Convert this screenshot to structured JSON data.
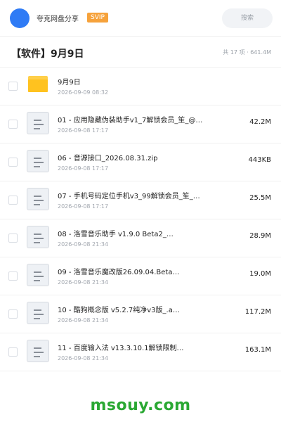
{
  "header": {
    "app_name": "夸克网盘分享",
    "badge": "SVIP",
    "search_placeholder": "搜索"
  },
  "folder": {
    "title": "【软件】9月9日",
    "summary": "共 17 项 · 641.4M"
  },
  "files": [
    {
      "type": "folder",
      "icon": "folder-icon",
      "name": "9月9日",
      "date": "2026-09-09 08:32",
      "size": ""
    },
    {
      "type": "file",
      "icon": "document-icon",
      "name": "01 - 应用隐藏伪装助手v1_7解锁会员_笙_@…",
      "date": "2026-09-08 17:17",
      "size": "42.2M"
    },
    {
      "type": "file",
      "icon": "document-icon",
      "name": "06 - 音源接口_2026.08.31.zip",
      "date": "2026-09-08 17:17",
      "size": "443KB"
    },
    {
      "type": "file",
      "icon": "document-icon",
      "name": "07 - 手机号码定位手机v3_99解锁会员_笙_…",
      "date": "2026-09-08 17:17",
      "size": "25.5M"
    },
    {
      "type": "file",
      "icon": "document-icon",
      "name": "08 - 洛雪音乐助手 v1.9.0 Beta2_…",
      "date": "2026-09-08 21:34",
      "size": "28.9M"
    },
    {
      "type": "file",
      "icon": "document-icon",
      "name": "09 - 洛雪音乐魔改版26.09.04.Beta…",
      "date": "2026-09-08 21:34",
      "size": "19.0M"
    },
    {
      "type": "file",
      "icon": "document-icon",
      "name": "10 - 酷狗概念版 v5.2.7纯净v3版_.a…",
      "date": "2026-09-08 21:34",
      "size": "117.2M"
    },
    {
      "type": "file",
      "icon": "document-icon",
      "name": "11 - 百度输入法 v13.3.10.1解锁限制…",
      "date": "2026-09-08 21:34",
      "size": "163.1M"
    }
  ],
  "watermark": "msouy.com",
  "colors": {
    "avatar": "#2f7bf5",
    "badge": "#f6a23b",
    "folder": "#ffc21f",
    "watermark": "#2aa833"
  }
}
